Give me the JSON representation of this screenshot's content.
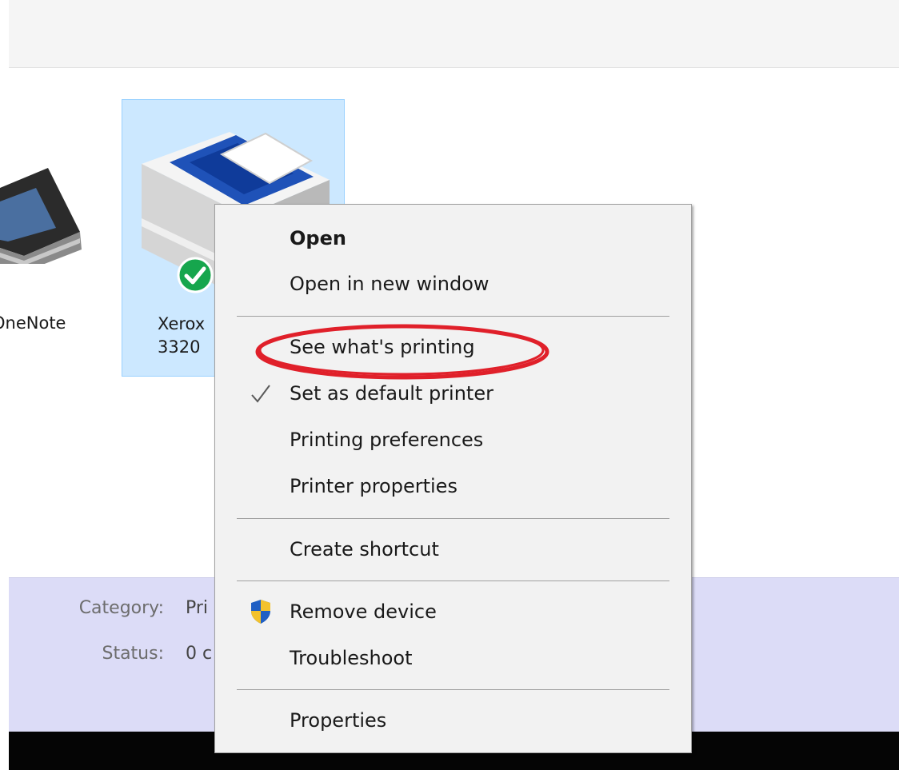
{
  "devices": [
    {
      "label": "OneNote"
    },
    {
      "label_line1": "Xerox",
      "label_line2": "3320"
    }
  ],
  "details": {
    "category_label": "Category:",
    "category_value": "Pri",
    "status_label": "Status:",
    "status_value": "0 c"
  },
  "context_menu": {
    "items": [
      {
        "label": "Open"
      },
      {
        "label": "Open in new window"
      },
      {
        "label": "See what's printing",
        "annotated": true
      },
      {
        "label": "Set as default printer",
        "checked": true
      },
      {
        "label": "Printing preferences"
      },
      {
        "label": "Printer properties"
      },
      {
        "label": "Create shortcut"
      },
      {
        "label": "Remove device",
        "icon": "uac-shield-icon"
      },
      {
        "label": "Troubleshoot"
      },
      {
        "label": "Properties"
      }
    ]
  },
  "colors": {
    "selection_fill": "#cce8ff",
    "selection_border": "#99d1ff",
    "annotation": "#e0202a",
    "details_pane": "#dcdcf7",
    "menu_bg": "#f2f2f2"
  }
}
